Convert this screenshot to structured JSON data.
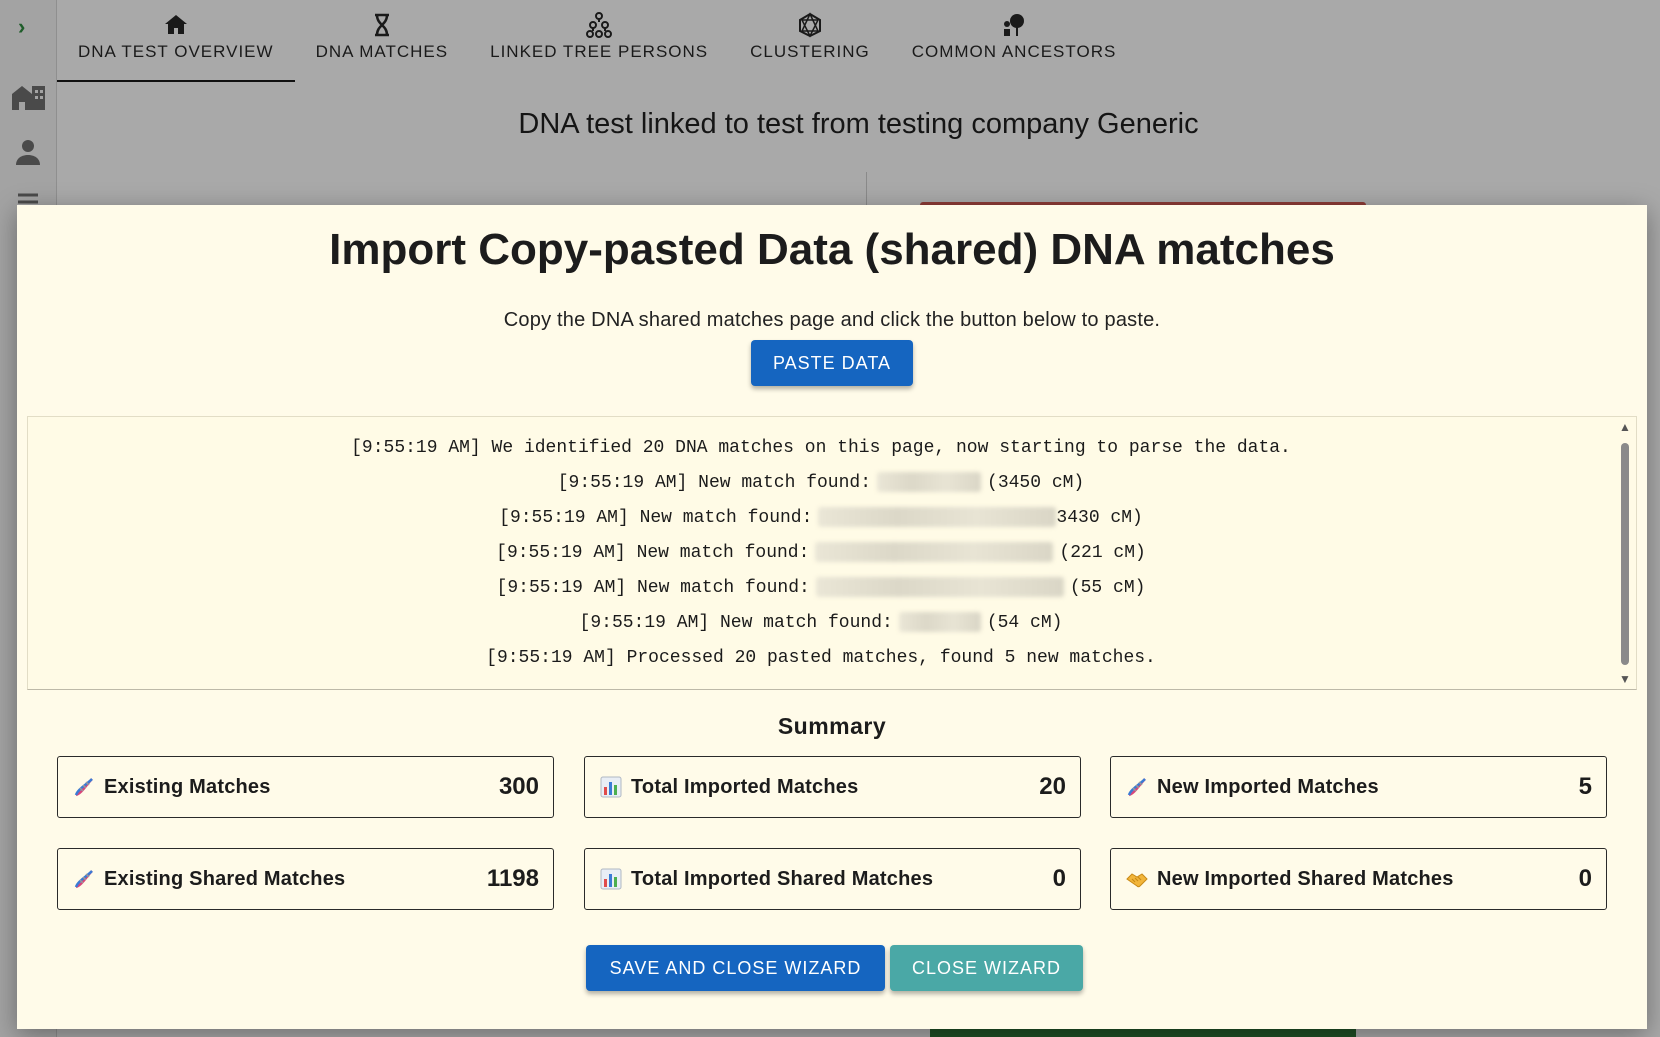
{
  "nav": {
    "tabs": [
      {
        "label": "DNA TEST OVERVIEW",
        "icon": "home-icon",
        "active": true
      },
      {
        "label": "DNA MATCHES",
        "icon": "dna-icon",
        "active": false
      },
      {
        "label": "LINKED TREE PERSONS",
        "icon": "tree-icon",
        "active": false
      },
      {
        "label": "CLUSTERING",
        "icon": "cluster-icon",
        "active": false
      },
      {
        "label": "COMMON ANCESTORS",
        "icon": "ancestors-icon",
        "active": false
      }
    ]
  },
  "page": {
    "heading": "DNA test linked to test from testing company Generic"
  },
  "modal": {
    "title": "Import Copy-pasted Data (shared) DNA matches",
    "instructions": "Copy the DNA shared matches page and click the button below to paste.",
    "paste_button": "PASTE DATA",
    "log": [
      {
        "prefix": "[9:55:19 AM] We identified 20 DNA matches on this page, now starting to parse the data.",
        "redacted": false,
        "suffix": ""
      },
      {
        "prefix": "[9:55:19 AM] New match found:",
        "redacted": true,
        "suffix": "(3450 cM)"
      },
      {
        "prefix": "[9:55:19 AM] New match found:",
        "redacted": true,
        "suffix": "3430 cM)"
      },
      {
        "prefix": "[9:55:19 AM] New match found:",
        "redacted": true,
        "suffix": "(221 cM)"
      },
      {
        "prefix": "[9:55:19 AM] New match found:",
        "redacted": true,
        "suffix": "(55 cM)"
      },
      {
        "prefix": "[9:55:19 AM] New match found:",
        "redacted": true,
        "suffix": "(54 cM)"
      },
      {
        "prefix": "[9:55:19 AM] Processed 20 pasted matches, found 5 new matches.",
        "redacted": false,
        "suffix": ""
      }
    ],
    "summary_title": "Summary",
    "stats": {
      "existing_matches": {
        "label": "Existing Matches",
        "value": "300",
        "icon": "dna-icon"
      },
      "total_imported_matches": {
        "label": "Total Imported Matches",
        "value": "20",
        "icon": "bar-chart-icon"
      },
      "new_imported_matches": {
        "label": "New Imported Matches",
        "value": "5",
        "icon": "dna-icon"
      },
      "existing_shared_matches": {
        "label": "Existing Shared Matches",
        "value": "1198",
        "icon": "dna-icon"
      },
      "total_imported_shared_matches": {
        "label": "Total Imported Shared Matches",
        "value": "0",
        "icon": "bar-chart-icon"
      },
      "new_imported_shared_matches": {
        "label": "New Imported Shared Matches",
        "value": "0",
        "icon": "handshake-icon"
      }
    },
    "save_button": "SAVE AND CLOSE WIZARD",
    "close_button": "CLOSE WIZARD"
  },
  "colors": {
    "primary": "#1565c0",
    "secondary": "#4aa8a6",
    "modal_bg": "#fffbe9",
    "sidebar_toggle": "#1f5d2a"
  }
}
